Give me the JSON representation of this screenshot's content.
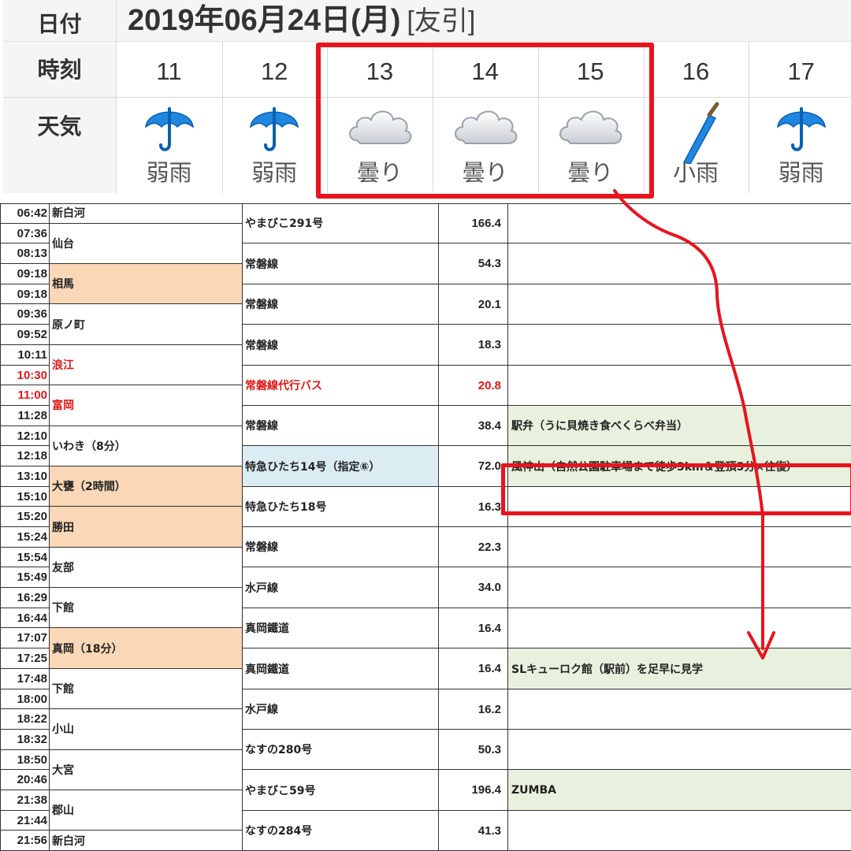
{
  "weather": {
    "labels": {
      "date": "日付",
      "time": "時刻",
      "weather": "天気"
    },
    "date": "2019年06月24日(月)",
    "rokuyo": "[友引]",
    "hours": [
      {
        "hour": "11",
        "icon": "umbrella-icon",
        "text": "弱雨"
      },
      {
        "hour": "12",
        "icon": "umbrella-icon",
        "text": "弱雨"
      },
      {
        "hour": "13",
        "icon": "cloud-icon",
        "text": "曇り"
      },
      {
        "hour": "14",
        "icon": "cloud-icon",
        "text": "曇り"
      },
      {
        "hour": "15",
        "icon": "cloud-icon",
        "text": "曇り"
      },
      {
        "hour": "16",
        "icon": "closed-umbrella-icon",
        "text": "小雨"
      },
      {
        "hour": "17",
        "icon": "umbrella-icon",
        "text": "弱雨"
      }
    ]
  },
  "schedule": {
    "times": [
      "06:42",
      "07:36",
      "08:13",
      "09:18",
      "09:18",
      "09:36",
      "09:52",
      "10:11",
      "10:30",
      "11:00",
      "11:28",
      "12:10",
      "12:18",
      "13:10",
      "15:10",
      "15:20",
      "15:24",
      "15:54",
      "15:49",
      "16:29",
      "16:44",
      "17:07",
      "17:25",
      "17:48",
      "18:00",
      "18:22",
      "18:32",
      "18:50",
      "20:46",
      "21:38",
      "21:44",
      "21:56"
    ],
    "places": [
      "新白河",
      "仙台",
      "相馬",
      "原ノ町",
      "浪江",
      "富岡",
      "いわき（8分）",
      "大甕（2時間）",
      "勝田",
      "友部",
      "下館",
      "真岡（18分）",
      "下館",
      "小山",
      "大宮",
      "郡山",
      "新白河"
    ],
    "routes": [
      "やまびこ291号",
      "常磐線",
      "常磐線",
      "常磐線",
      "常磐線代行バス",
      "常磐線",
      "特急ひたち14号（指定⑥）",
      "特急ひたち18号",
      "常磐線",
      "水戸線",
      "真岡鐵道",
      "真岡鐵道",
      "水戸線",
      "なすの280号",
      "やまびこ59号",
      "なすの284号"
    ],
    "distances": [
      "166.4",
      "54.3",
      "20.1",
      "18.3",
      "20.8",
      "38.4",
      "72.0",
      "16.3",
      "22.3",
      "34.0",
      "16.4",
      "16.4",
      "16.2",
      "50.3",
      "196.4",
      "41.3"
    ],
    "notes": [
      "駅弁（うに貝焼き食べくらべ弁当）",
      "風神山（自然公園駐車場まで徒歩3km＆登頂5分×往復）",
      "SLキューロク館（駅前）を足早に見学",
      "ZUMBA"
    ]
  },
  "colors": {
    "highlight": "#e8141e",
    "accent_red": "#e01818",
    "orange_row": "#fad7b7",
    "blue_row": "#dbedf3",
    "green_row": "#e8f1de"
  }
}
